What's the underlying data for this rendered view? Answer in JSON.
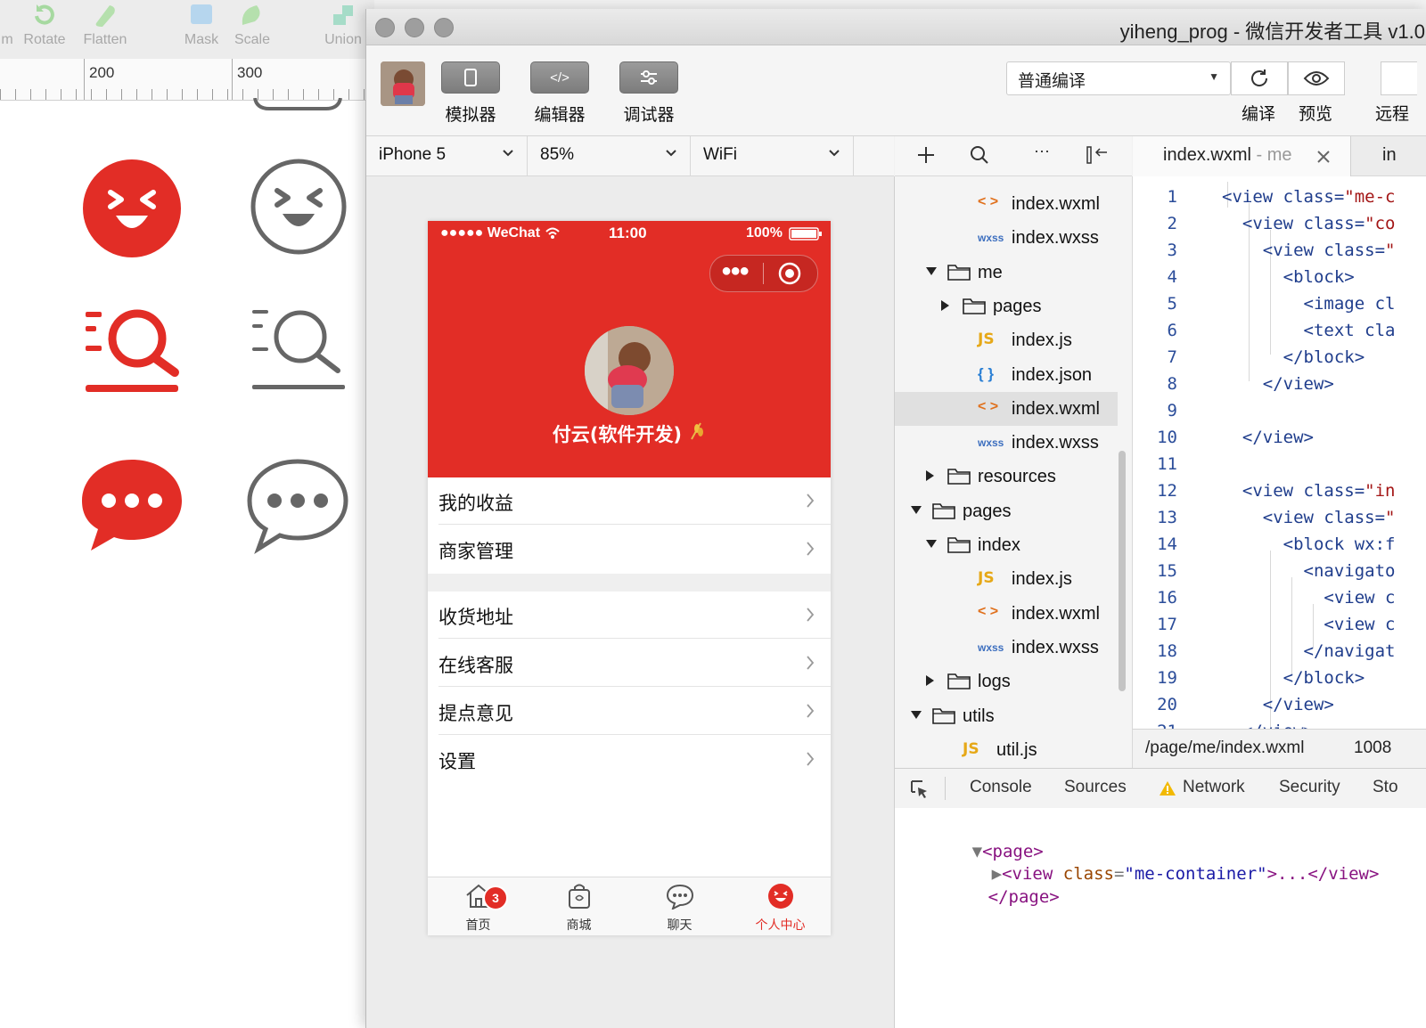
{
  "sketch": {
    "tools": [
      {
        "label": "m",
        "icon": "partial-tool-icon"
      },
      {
        "label": "Rotate",
        "icon": "rotate-icon"
      },
      {
        "label": "Flatten",
        "icon": "flatten-icon"
      },
      {
        "label": "Mask",
        "icon": "mask-icon"
      },
      {
        "label": "Scale",
        "icon": "scale-icon"
      },
      {
        "label": "Union",
        "icon": "union-icon"
      }
    ],
    "ruler": [
      "200",
      "300"
    ],
    "accent": "#e22d26",
    "gray": "#666666"
  },
  "window": {
    "title": "yiheng_prog - 微信开发者工具 v1.0"
  },
  "toolbar": {
    "simulator": "模拟器",
    "editor": "编辑器",
    "debugger": "调试器",
    "compile_mode": "普通编译",
    "compile": "编译",
    "preview": "预览",
    "remote": "远程"
  },
  "simulator": {
    "device": "iPhone 5",
    "zoom": "85%",
    "network": "WiFi"
  },
  "phone": {
    "carrier": "●●●●● WeChat",
    "time": "11:00",
    "battery": "100%",
    "name": "付云(软件开发)",
    "menu1": [
      "我的收益",
      "商家管理"
    ],
    "menu2": [
      "收货地址",
      "在线客服",
      "提点意见",
      "设置"
    ],
    "tabs": [
      "首页",
      "商城",
      "聊天",
      "个人中心"
    ],
    "badge": "3",
    "accent": "#e22d26"
  },
  "tree": [
    {
      "name": "index.wxml",
      "icon": "wxml",
      "depth": 3,
      "tw": "none"
    },
    {
      "name": "index.wxss",
      "icon": "wxss",
      "depth": 3,
      "tw": "none"
    },
    {
      "name": "me",
      "icon": "folder",
      "depth": 1,
      "tw": "down"
    },
    {
      "name": "pages",
      "icon": "folder",
      "depth": 2,
      "tw": "right"
    },
    {
      "name": "index.js",
      "icon": "js",
      "depth": 3,
      "tw": "none"
    },
    {
      "name": "index.json",
      "icon": "json",
      "depth": 3,
      "tw": "none"
    },
    {
      "name": "index.wxml",
      "icon": "wxml",
      "depth": 3,
      "tw": "none",
      "selected": true
    },
    {
      "name": "index.wxss",
      "icon": "wxss",
      "depth": 3,
      "tw": "none"
    },
    {
      "name": "resources",
      "icon": "folder",
      "depth": 1,
      "tw": "right"
    },
    {
      "name": "pages",
      "icon": "folder",
      "depth": 0,
      "tw": "down"
    },
    {
      "name": "index",
      "icon": "folder",
      "depth": 1,
      "tw": "down"
    },
    {
      "name": "index.js",
      "icon": "js",
      "depth": 3,
      "tw": "none"
    },
    {
      "name": "index.wxml",
      "icon": "wxml",
      "depth": 3,
      "tw": "none"
    },
    {
      "name": "index.wxss",
      "icon": "wxss",
      "depth": 3,
      "tw": "none"
    },
    {
      "name": "logs",
      "icon": "folder",
      "depth": 1,
      "tw": "right"
    },
    {
      "name": "utils",
      "icon": "folder",
      "depth": 0,
      "tw": "down"
    },
    {
      "name": "util.js",
      "icon": "js",
      "depth": 2,
      "tw": "none"
    }
  ],
  "file_icons": {
    "js": "JS",
    "wxml": "< >",
    "json": "{ }",
    "wxss": "wxss"
  },
  "editor": {
    "tab_name": "index.wxml",
    "tab_sep": " - ",
    "tab_dir": "me",
    "tab2": "in",
    "lines": [
      "<view class=\"me-c",
      "  <view class=\"co",
      "    <view class=\"",
      "      <block>",
      "        <image cl",
      "        <text cla",
      "      </block>",
      "    </view>",
      "",
      "  </view>",
      "",
      "  <view class=\"in",
      "    <view class=\"",
      "      <block wx:f",
      "        <navigato",
      "          <view c",
      "          <view c",
      "        </navigat",
      "      </block>",
      "    </view>",
      "  </view>"
    ],
    "status_path": "/page/me/index.wxml",
    "status_size": "1008"
  },
  "devtools": {
    "tabs": [
      "Console",
      "Sources",
      "Network",
      "Security",
      "Sto"
    ],
    "dom_page_open": "<page>",
    "dom_view_tag": "view",
    "dom_attr_name": "class",
    "dom_attr_value": "\"me-container\"",
    "dom_collapsed": ">...</view>",
    "dom_page_close": "</page>"
  }
}
